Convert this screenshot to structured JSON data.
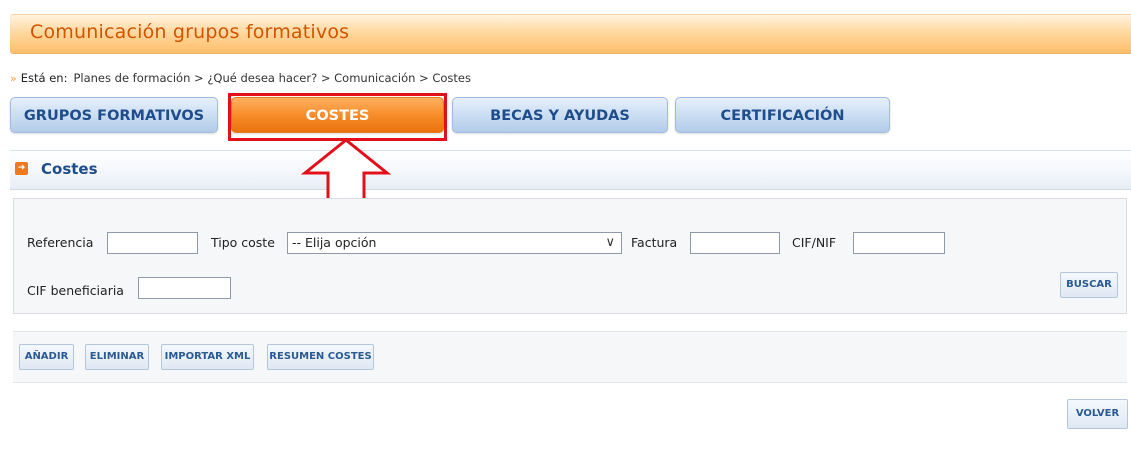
{
  "header": {
    "title": "Comunicación grupos formativos"
  },
  "breadcrumb": {
    "arrow": "»",
    "lead": "Está en:",
    "path": "Planes de formación > ¿Qué desea hacer? > Comunicación > Costes"
  },
  "tabs": [
    {
      "label": "GRUPOS FORMATIVOS",
      "active": false
    },
    {
      "label": "COSTES",
      "active": true
    },
    {
      "label": "BECAS Y AYUDAS",
      "active": false
    },
    {
      "label": "CERTIFICACIÓN",
      "active": false
    }
  ],
  "section": {
    "title": "Costes",
    "icon": "arrow-right-icon"
  },
  "filters": {
    "referencia_label": "Referencia",
    "referencia_value": "",
    "tipo_coste_label": "Tipo coste",
    "tipo_coste_value": "-- Elija opción",
    "factura_label": "Factura",
    "factura_value": "",
    "cif_nif_label": "CIF/NIF",
    "cif_nif_value": "",
    "cif_beneficiaria_label": "CIF beneficiaria",
    "cif_beneficiaria_value": "",
    "buscar_label": "BUSCAR"
  },
  "actions": {
    "anadir": "AÑADIR",
    "eliminar": "ELIMINAR",
    "importar_xml": "IMPORTAR XML",
    "resumen_costes": "RESUMEN COSTES"
  },
  "footer": {
    "volver": "VOLVER"
  },
  "colors": {
    "header_text": "#d35400",
    "tab_text": "#1f4c8a",
    "active_tab": "#f68a26",
    "highlight_red": "#e2101a"
  }
}
